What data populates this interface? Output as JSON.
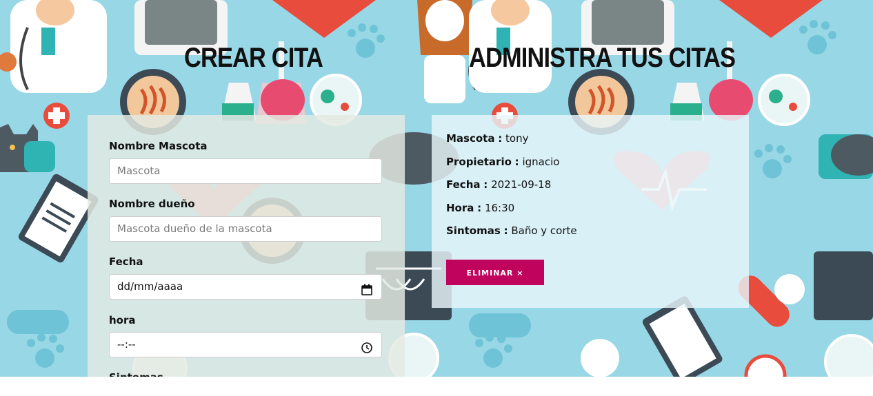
{
  "left": {
    "title": "Crear cita",
    "form": {
      "mascota": {
        "label": "Nombre Mascota",
        "placeholder": "Mascota"
      },
      "propietario": {
        "label": "Nombre dueño",
        "placeholder": "Mascota dueño de la mascota"
      },
      "fecha": {
        "label": "Fecha",
        "placeholder": "dd/mm/aaaa"
      },
      "hora": {
        "label": "hora",
        "placeholder": "--:--"
      },
      "sintomas": {
        "label": "Sintomas"
      }
    }
  },
  "right": {
    "title": "Administra tus citas",
    "cita": {
      "mascota": {
        "key": "Mascota",
        "sep": ":",
        "value": "tony"
      },
      "propietario": {
        "key": "Propietario",
        "sep": ":",
        "value": "ignacio"
      },
      "fecha": {
        "key": "Fecha",
        "sep": ":",
        "value": "2021-09-18"
      },
      "hora": {
        "key": "Hora",
        "sep": ":",
        "value": "16:30"
      },
      "sintomas": {
        "key": "Sintomas",
        "sep": ":",
        "value": "Baño y corte"
      },
      "delete_label": "ELIMINAR ×"
    }
  },
  "colors": {
    "background": "#98d7e6",
    "delete_button": "#c0045d",
    "form_panel": "rgba(228,233,226,0.84)"
  },
  "icons": [
    "calendar-icon",
    "clock-icon"
  ]
}
